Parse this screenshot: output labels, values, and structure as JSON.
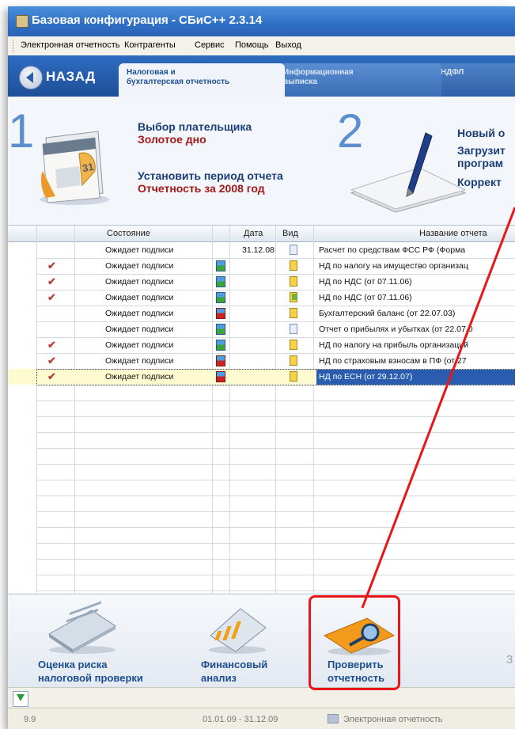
{
  "window": {
    "title": "Базовая конфигурация - СБиС++ 2.3.14"
  },
  "menu": [
    "Электронная отчетность",
    "Контрагенты",
    "Сервис",
    "Помощь",
    "Выход"
  ],
  "nav": {
    "back_label": "НАЗАД",
    "tabs": [
      {
        "line1": "Налоговая и",
        "line2": "бухгалтерская отчетность"
      },
      {
        "line1": "Информационная",
        "line2": "выписка"
      },
      {
        "line1": "2-НДФЛ",
        "line2": ""
      }
    ]
  },
  "steps": {
    "step1": {
      "number": "1",
      "payer_label": "Выбор плательщика",
      "payer_value": "Золотое дно",
      "period_label": "Установить период отчета",
      "period_value": "Отчетность за 2008 год",
      "calendar_day": "31"
    },
    "step2": {
      "number": "2",
      "line1": "Новый о",
      "line2": "Загрузит",
      "line3": "програм",
      "line4": "Коррект"
    }
  },
  "table": {
    "headers": {
      "state": "Состояние",
      "date": "Дата",
      "kind": "Вид",
      "name": "Название отчета"
    },
    "rows": [
      {
        "check": false,
        "state": "Ожидает подписи",
        "status_icon": "none",
        "date": "31.12.08",
        "kind_icon": "doc-blue",
        "name": "Расчет по средствам ФСС РФ (Форма"
      },
      {
        "check": true,
        "state": "Ожидает подписи",
        "status_icon": "green",
        "date": "",
        "kind_icon": "doc-yellow",
        "name": "НД по налогу на имущество организац"
      },
      {
        "check": true,
        "state": "Ожидает подписи",
        "status_icon": "green",
        "date": "",
        "kind_icon": "doc-yellow",
        "name": "НД по НДС (от 07.11.06)"
      },
      {
        "check": true,
        "state": "Ожидает подписи",
        "status_icon": "green",
        "date": "",
        "kind_icon": "doc-green",
        "name": "НД по НДС (от 07.11.06)"
      },
      {
        "check": false,
        "state": "Ожидает подписи",
        "status_icon": "red",
        "date": "",
        "kind_icon": "doc-yellow",
        "name": "Бухгалтерский баланс (от 22.07.03)"
      },
      {
        "check": false,
        "state": "Ожидает подписи",
        "status_icon": "green",
        "date": "",
        "kind_icon": "doc-blue",
        "name": "Отчет о прибылях и убытках (от 22.07.0"
      },
      {
        "check": true,
        "state": "Ожидает подписи",
        "status_icon": "green",
        "date": "",
        "kind_icon": "doc-yellow",
        "name": "НД по налогу на прибыль организаций"
      },
      {
        "check": true,
        "state": "Ожидает подписи",
        "status_icon": "red",
        "date": "",
        "kind_icon": "doc-yellow",
        "name": "НД по страховым взносам в ПФ (от 27"
      },
      {
        "check": true,
        "state": "Ожидает подписи",
        "status_icon": "red",
        "date": "",
        "kind_icon": "doc-yellow",
        "name": "НД по ЕСН (от 29.12.07)"
      }
    ]
  },
  "actions": {
    "risk_line1": "Оценка риска",
    "risk_line2": "налоговой проверки",
    "fin_line1": "Финансовый",
    "fin_line2": "анализ",
    "check_line1": "Проверить",
    "check_line2": "отчетность",
    "partial_digit": "3"
  },
  "status": {
    "version": "9.9",
    "period": "01.01.09 - 31.12.09",
    "module": "Электронная отчетность"
  },
  "colors": {
    "highlight": "#e81616",
    "accent": "#2a5db0",
    "title_red": "#a31818"
  }
}
